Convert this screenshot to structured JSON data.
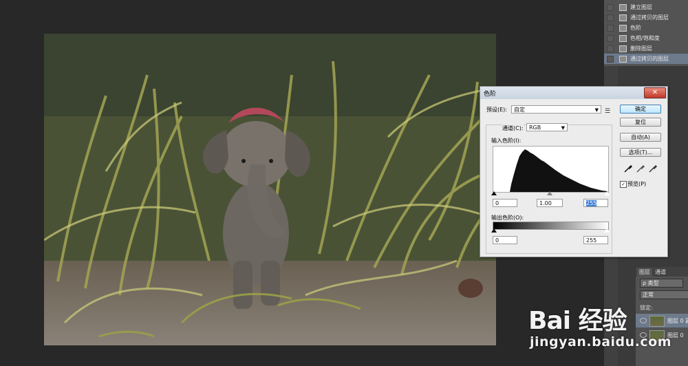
{
  "history": {
    "items": [
      {
        "label": "建立图层"
      },
      {
        "label": "通过拷贝的图层"
      },
      {
        "label": "色阶"
      },
      {
        "label": "色相/饱和度"
      },
      {
        "label": "删除图层"
      },
      {
        "label": "通过拷贝的图层"
      }
    ]
  },
  "levels_dialog": {
    "title": "色阶",
    "close_label": "✕",
    "preset_label": "预设(E):",
    "preset_value": "自定",
    "channel_label": "通道(C):",
    "channel_value": "RGB",
    "input_levels_label": "输入色阶(I):",
    "input_black": "0",
    "input_gamma": "1.00",
    "input_white": "255",
    "output_levels_label": "输出色阶(O):",
    "output_black": "0",
    "output_white": "255",
    "buttons": {
      "ok": "确定",
      "reset": "复位",
      "auto": "自动(A)",
      "options": "选项(T)..."
    },
    "preview_label": "预览(P)",
    "preview_checked": true
  },
  "layers_panel": {
    "tab_layers": "图层",
    "tab_channels": "通道",
    "kind_label": "类型",
    "blend_mode": "正常",
    "lock_label": "锁定:",
    "layers": [
      {
        "name": "图层 0 副本"
      },
      {
        "name": "图层 0"
      }
    ]
  },
  "watermark": {
    "brand": "Bai 经验",
    "url": "jingyan.baidu.com"
  },
  "colors": {
    "workspace": "#282828",
    "panel": "#535353",
    "selection": "#6d7a8c",
    "dialog": "#ececec"
  }
}
